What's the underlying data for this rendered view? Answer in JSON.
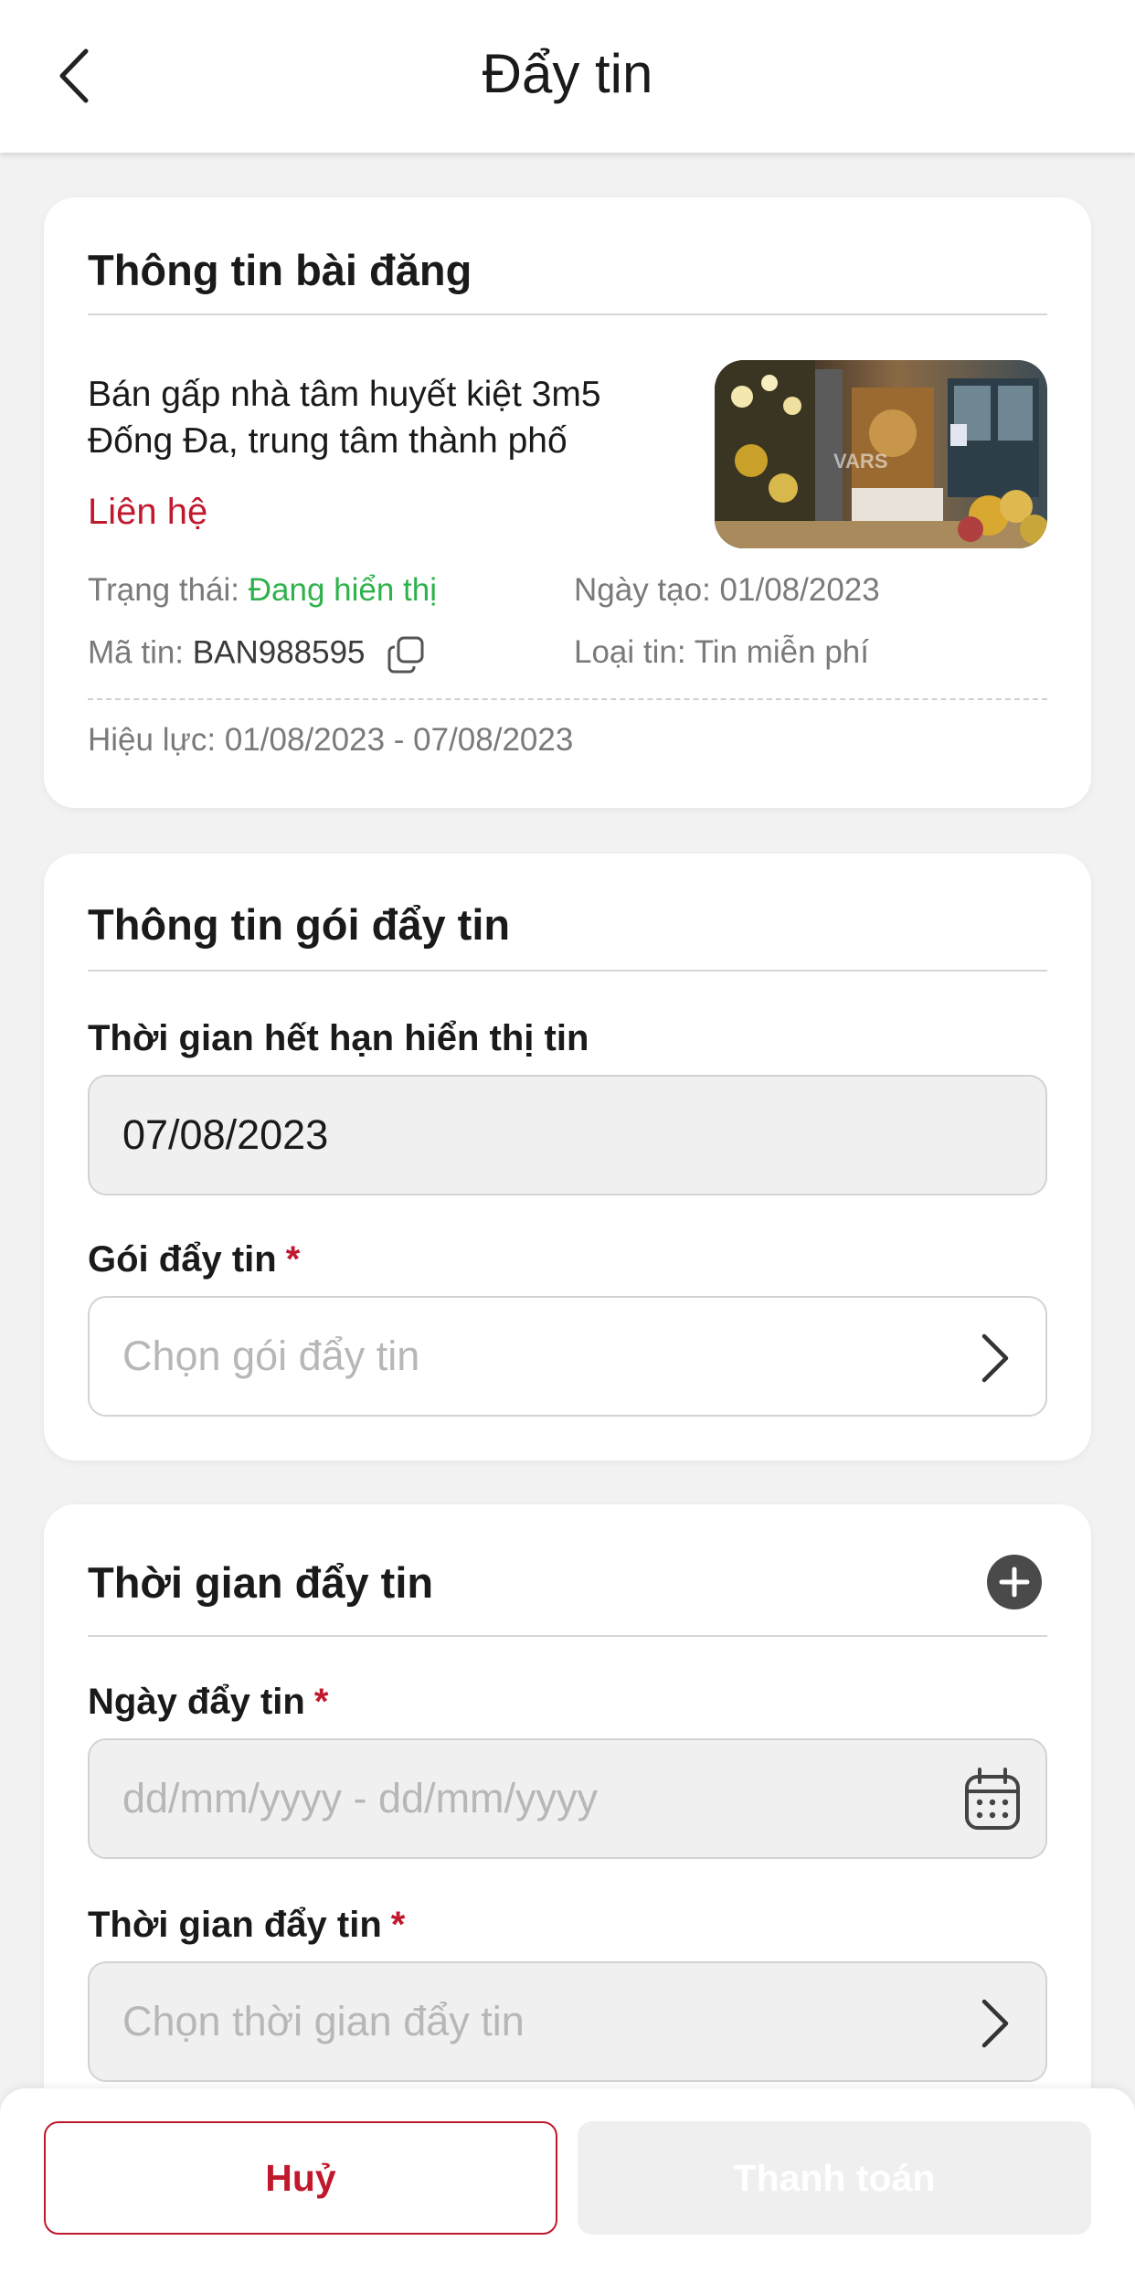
{
  "header": {
    "title": "Đẩy tin"
  },
  "post_card": {
    "title": "Thông tin bài đăng",
    "post_title": "Bán gấp nhà tâm huyết kiệt 3m5 Đống Đa, trung tâm thành phố",
    "price": "Liên hệ",
    "status_label": "Trạng thái: ",
    "status_value": "Đang hiển thị",
    "created_label": "Ngày tạo: ",
    "created_value": "01/08/2023",
    "code_label": "Mã tin: ",
    "code_value": "BAN988595",
    "type_label": "Loại tin: ",
    "type_value": "Tin miễn phí",
    "validity_label": "Hiệu lực: ",
    "validity_value": "01/08/2023 - 07/08/2023",
    "watermark": "VARS"
  },
  "package_card": {
    "title": "Thông tin gói đẩy tin",
    "expiry_label": "Thời gian hết hạn hiển thị tin",
    "expiry_value": "07/08/2023",
    "package_label": "Gói đẩy tin",
    "required_mark": "*",
    "package_placeholder": "Chọn gói đẩy tin"
  },
  "push_time_card": {
    "title": "Thời gian đẩy tin",
    "date_label": "Ngày đẩy tin",
    "date_placeholder": "dd/mm/yyyy - dd/mm/yyyy",
    "time_label": "Thời gian đẩy tin",
    "time_placeholder": "Chọn thời gian đẩy tin"
  },
  "footer": {
    "cancel_label": "Huỷ",
    "pay_label": "Thanh toán"
  },
  "colors": {
    "accent": "#c0192d",
    "status_green": "#2fb24c",
    "disabled_button": "#efefef"
  },
  "icons": [
    "chevron-left-icon",
    "copy-icon",
    "chevron-right-icon",
    "calendar-icon",
    "plus-circle-icon"
  ]
}
